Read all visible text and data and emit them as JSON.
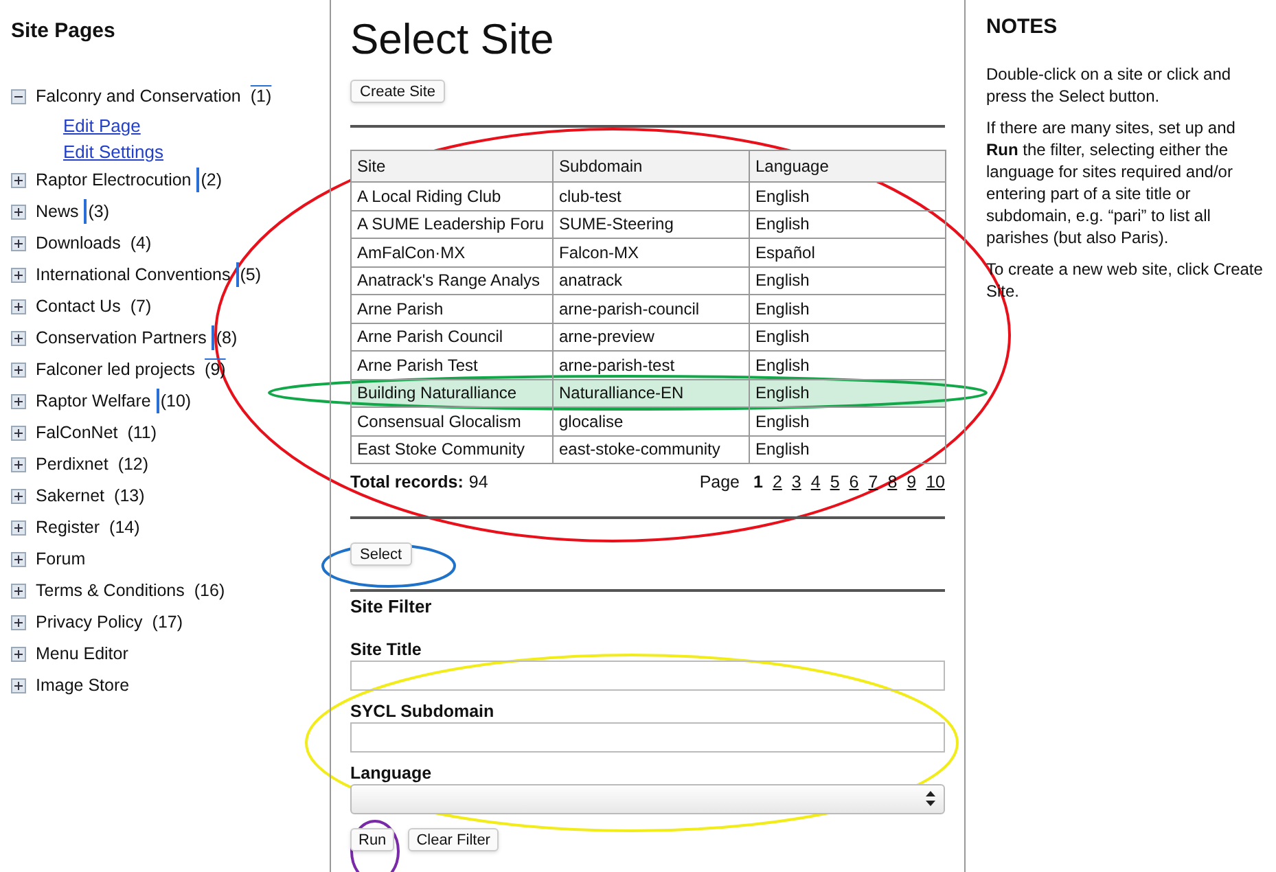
{
  "sidebar": {
    "title": "Site Pages",
    "items": [
      {
        "label": "Falconry and Conservation",
        "count": "(1)",
        "expanded": true,
        "cursor": false,
        "overlined": true,
        "children": [
          {
            "label": "Edit Page"
          },
          {
            "label": "Edit Settings"
          }
        ]
      },
      {
        "label": "Raptor Electrocution",
        "count": "(2)",
        "expanded": false,
        "cursor": true,
        "overlined": false
      },
      {
        "label": "News",
        "count": "(3)",
        "expanded": false,
        "cursor": true,
        "overlined": false
      },
      {
        "label": "Downloads",
        "count": "(4)",
        "expanded": false,
        "cursor": false,
        "overlined": false
      },
      {
        "label": "International Conventions",
        "count": "(5)",
        "expanded": false,
        "cursor": true,
        "overlined": false
      },
      {
        "label": "Contact Us",
        "count": "(7)",
        "expanded": false,
        "cursor": false,
        "overlined": false
      },
      {
        "label": "Conservation Partners",
        "count": "(8)",
        "expanded": false,
        "cursor": true,
        "overlined": false
      },
      {
        "label": "Falconer led projects",
        "count": "(9)",
        "expanded": false,
        "cursor": false,
        "overlined": true
      },
      {
        "label": "Raptor Welfare",
        "count": "(10)",
        "expanded": false,
        "cursor": true,
        "overlined": false
      },
      {
        "label": "FalConNet",
        "count": "(11)",
        "expanded": false,
        "cursor": false,
        "overlined": false
      },
      {
        "label": "Perdixnet",
        "count": "(12)",
        "expanded": false,
        "cursor": false,
        "overlined": false
      },
      {
        "label": "Sakernet",
        "count": "(13)",
        "expanded": false,
        "cursor": false,
        "overlined": false
      },
      {
        "label": "Register",
        "count": "(14)",
        "expanded": false,
        "cursor": false,
        "overlined": false
      },
      {
        "label": "Forum",
        "expanded": false
      },
      {
        "label": "Terms & Conditions",
        "count": "(16)",
        "expanded": false,
        "cursor": false,
        "overlined": false
      },
      {
        "label": "Privacy Policy",
        "count": "(17)",
        "expanded": false,
        "cursor": false,
        "overlined": false
      },
      {
        "label": "Menu Editor",
        "expanded": false
      },
      {
        "label": "Image Store",
        "expanded": false
      }
    ]
  },
  "main": {
    "title": "Select Site",
    "create_button": "Create Site",
    "table": {
      "columns": [
        "Site",
        "Subdomain",
        "Language"
      ],
      "rows": [
        {
          "cells": [
            "A Local Riding Club",
            "club-test",
            "English"
          ],
          "selected": false
        },
        {
          "cells": [
            "A SUME Leadership Foru",
            "SUME-Steering",
            "English"
          ],
          "selected": false
        },
        {
          "cells": [
            "AmFalCon·MX",
            "Falcon-MX",
            "Español"
          ],
          "selected": false
        },
        {
          "cells": [
            "Anatrack's Range Analys",
            "anatrack",
            "English"
          ],
          "selected": false
        },
        {
          "cells": [
            "Arne Parish",
            "arne-parish-council",
            "English"
          ],
          "selected": false
        },
        {
          "cells": [
            "Arne Parish Council",
            "arne-preview",
            "English"
          ],
          "selected": false
        },
        {
          "cells": [
            "Arne Parish Test",
            "arne-parish-test",
            "English"
          ],
          "selected": false
        },
        {
          "cells": [
            "Building Naturalliance",
            "Naturalliance-EN",
            "English"
          ],
          "selected": true
        },
        {
          "cells": [
            "Consensual Glocalism",
            "glocalise",
            "English"
          ],
          "selected": false
        },
        {
          "cells": [
            "East Stoke Community",
            "east-stoke-community",
            "English"
          ],
          "selected": false
        }
      ]
    },
    "total_label": "Total records:",
    "total_value": "94",
    "pager": {
      "label": "Page",
      "pages": [
        {
          "label": "1",
          "selected": true
        },
        {
          "label": "2",
          "selected": false
        },
        {
          "label": "3",
          "selected": false
        },
        {
          "label": "4",
          "selected": false
        },
        {
          "label": "5",
          "selected": false
        },
        {
          "label": "6",
          "selected": false
        },
        {
          "label": "7",
          "selected": false
        },
        {
          "label": "8",
          "selected": false
        },
        {
          "label": "9",
          "selected": false
        },
        {
          "label": "10",
          "selected": false
        }
      ]
    },
    "select_button": "Select",
    "filter": {
      "title": "Site Filter",
      "fields": [
        {
          "label": "Site Title",
          "kind": "text"
        },
        {
          "label": "SYCL Subdomain",
          "kind": "text"
        },
        {
          "label": "Language",
          "kind": "select"
        }
      ],
      "buttons": [
        "Run",
        "Clear Filter"
      ]
    }
  },
  "notes": {
    "title": "NOTES",
    "paragraphs": [
      "Double-click on a site or click and press the Select button.",
      "If there are many sites, set up and **Run** the filter, selecting either the language for sites required and/or entering part of a site title or subdomain, e.g. “pari” to list all parishes (but also Paris).",
      "To create a new web site, click Create Site."
    ]
  },
  "annotations": [
    {
      "color": "#e8101a"
    },
    {
      "color": "#12a84a"
    },
    {
      "color": "#1f72c8"
    },
    {
      "color": "#f2ec1a"
    },
    {
      "color": "#7a2aa8"
    }
  ]
}
